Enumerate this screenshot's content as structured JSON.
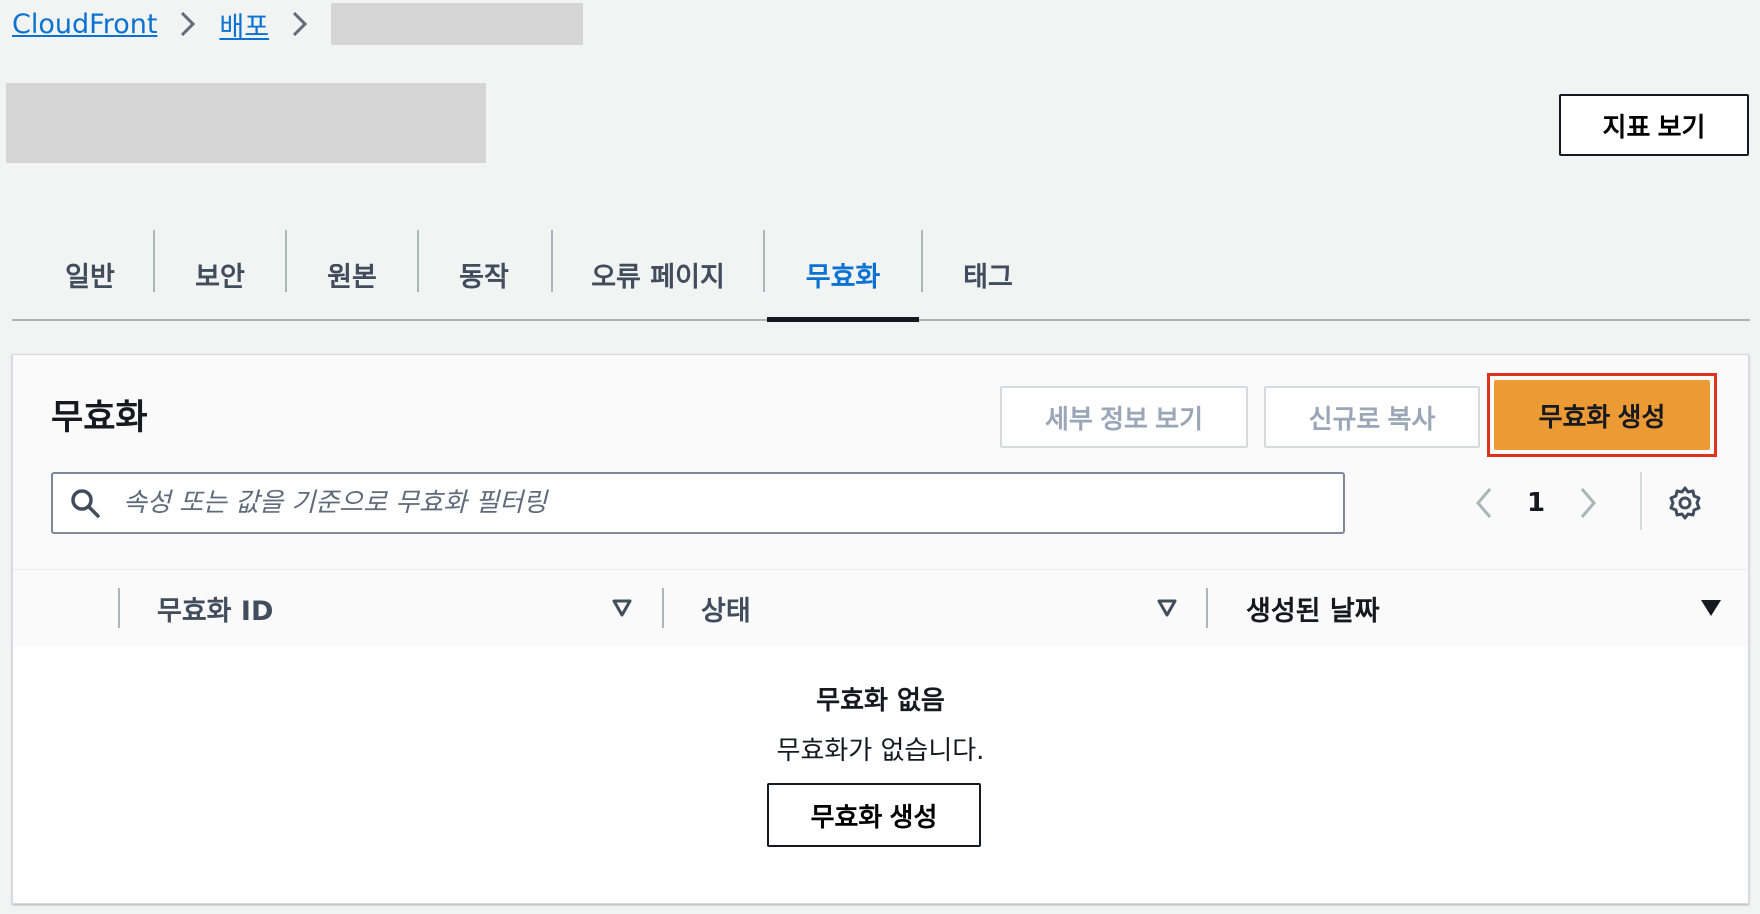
{
  "breadcrumb": {
    "items": [
      {
        "label": "CloudFront"
      },
      {
        "label": "배포"
      }
    ]
  },
  "header": {
    "view_metrics_label": "지표 보기"
  },
  "tabs": [
    {
      "label": "일반"
    },
    {
      "label": "보안"
    },
    {
      "label": "원본"
    },
    {
      "label": "동작"
    },
    {
      "label": "오류 페이지"
    },
    {
      "label": "무효화",
      "active": true
    },
    {
      "label": "태그"
    }
  ],
  "invalidations": {
    "title": "무효화",
    "view_details_label": "세부 정보 보기",
    "copy_new_label": "신규로 복사",
    "create_label": "무효화 생성",
    "search_placeholder": "속성 또는 값을 기준으로 무효화 필터링",
    "search_value": "",
    "page_number": "1",
    "columns": [
      {
        "label": "무효화 ID"
      },
      {
        "label": "상태"
      },
      {
        "label": "생성된 날짜"
      }
    ],
    "empty_title": "무효화 없음",
    "empty_text": "무효화가 없습니다.",
    "empty_create_label": "무효화 생성"
  },
  "colors": {
    "link": "#0972d3",
    "primary_button": "#ec9a34",
    "highlight_outline": "#e0301e",
    "text": "#16191f"
  },
  "icons": [
    "chevron-right-icon",
    "search-icon",
    "chevron-left-icon",
    "settings-icon",
    "sort-icon",
    "sort-descending-icon"
  ]
}
